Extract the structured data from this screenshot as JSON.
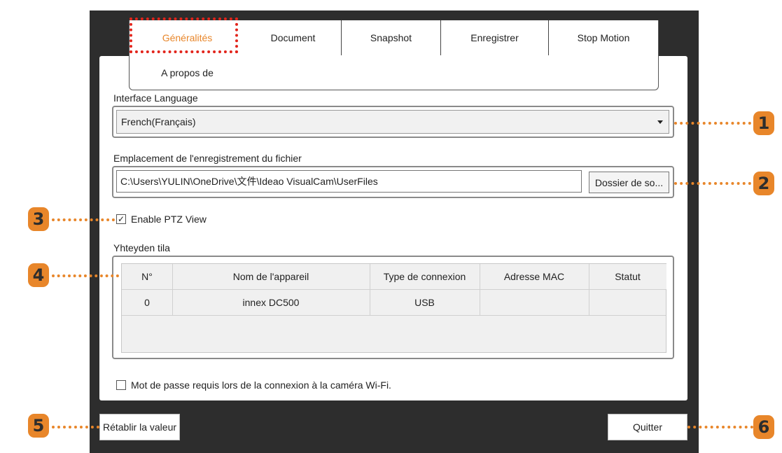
{
  "tabs": [
    {
      "label": "Généralités",
      "active": true
    },
    {
      "label": "Document"
    },
    {
      "label": "Snapshot"
    },
    {
      "label": "Enregistrer"
    },
    {
      "label": "Stop Motion"
    },
    {
      "label": "A propos de"
    }
  ],
  "language": {
    "label": "Interface Language",
    "value": "French(Français)"
  },
  "storage": {
    "label": "Emplacement de l'enregistrement du fichier",
    "path": "C:\\Users\\YULIN\\OneDrive\\文件\\Ideao VisualCam\\UserFiles",
    "browse_label": "Dossier de so..."
  },
  "ptz": {
    "label": "Enable PTZ View",
    "checked": true
  },
  "connection": {
    "label": "Yhteyden tila",
    "columns": [
      "N°",
      "Nom de l'appareil",
      "Type de connexion",
      "Adresse MAC",
      "Statut"
    ],
    "rows": [
      [
        "0",
        "innex DC500",
        "USB",
        "",
        ""
      ]
    ]
  },
  "wifi_password": {
    "label": "Mot de passe requis lors de la connexion à la caméra Wi-Fi.",
    "checked": false
  },
  "buttons": {
    "reset": "Rétablir la valeur",
    "quit": "Quitter"
  },
  "callouts": [
    "1",
    "2",
    "3",
    "4",
    "5",
    "6"
  ],
  "colors": {
    "accent": "#e8862a",
    "highlight": "#e2241b",
    "frame": "#2d2d2d"
  }
}
